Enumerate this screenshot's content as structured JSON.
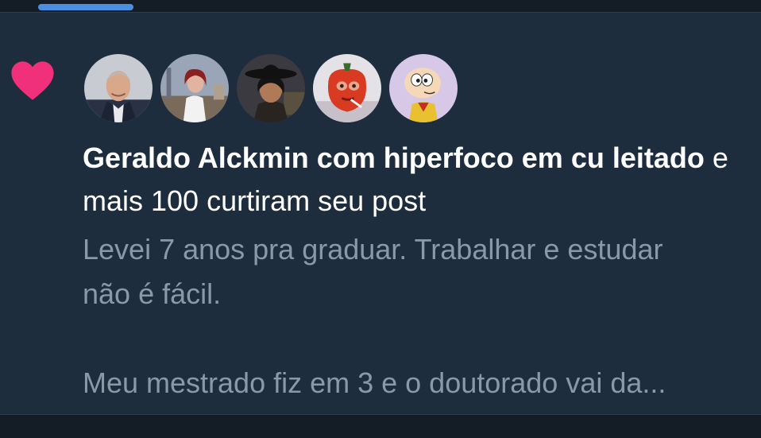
{
  "notification": {
    "type": "like",
    "icon": "heart-icon",
    "accent_color": "#f0307a",
    "avatars": [
      {
        "name": "avatar-1"
      },
      {
        "name": "avatar-2"
      },
      {
        "name": "avatar-3"
      },
      {
        "name": "avatar-4"
      },
      {
        "name": "avatar-5"
      }
    ],
    "actor_name": "Geraldo Alckmin com hiperfoco em cu leitado",
    "action_text": " e mais 100 curtiram seu post",
    "post_preview": {
      "line1": "Levei 7 anos pra graduar. Trabalhar e estudar",
      "line2": "não é fácil.",
      "line3": "Meu mestrado fiz em 3 e o doutorado vai da..."
    }
  },
  "colors": {
    "background": "#1e2d3e",
    "text_primary": "#ffffff",
    "text_secondary": "#8b98a5"
  }
}
